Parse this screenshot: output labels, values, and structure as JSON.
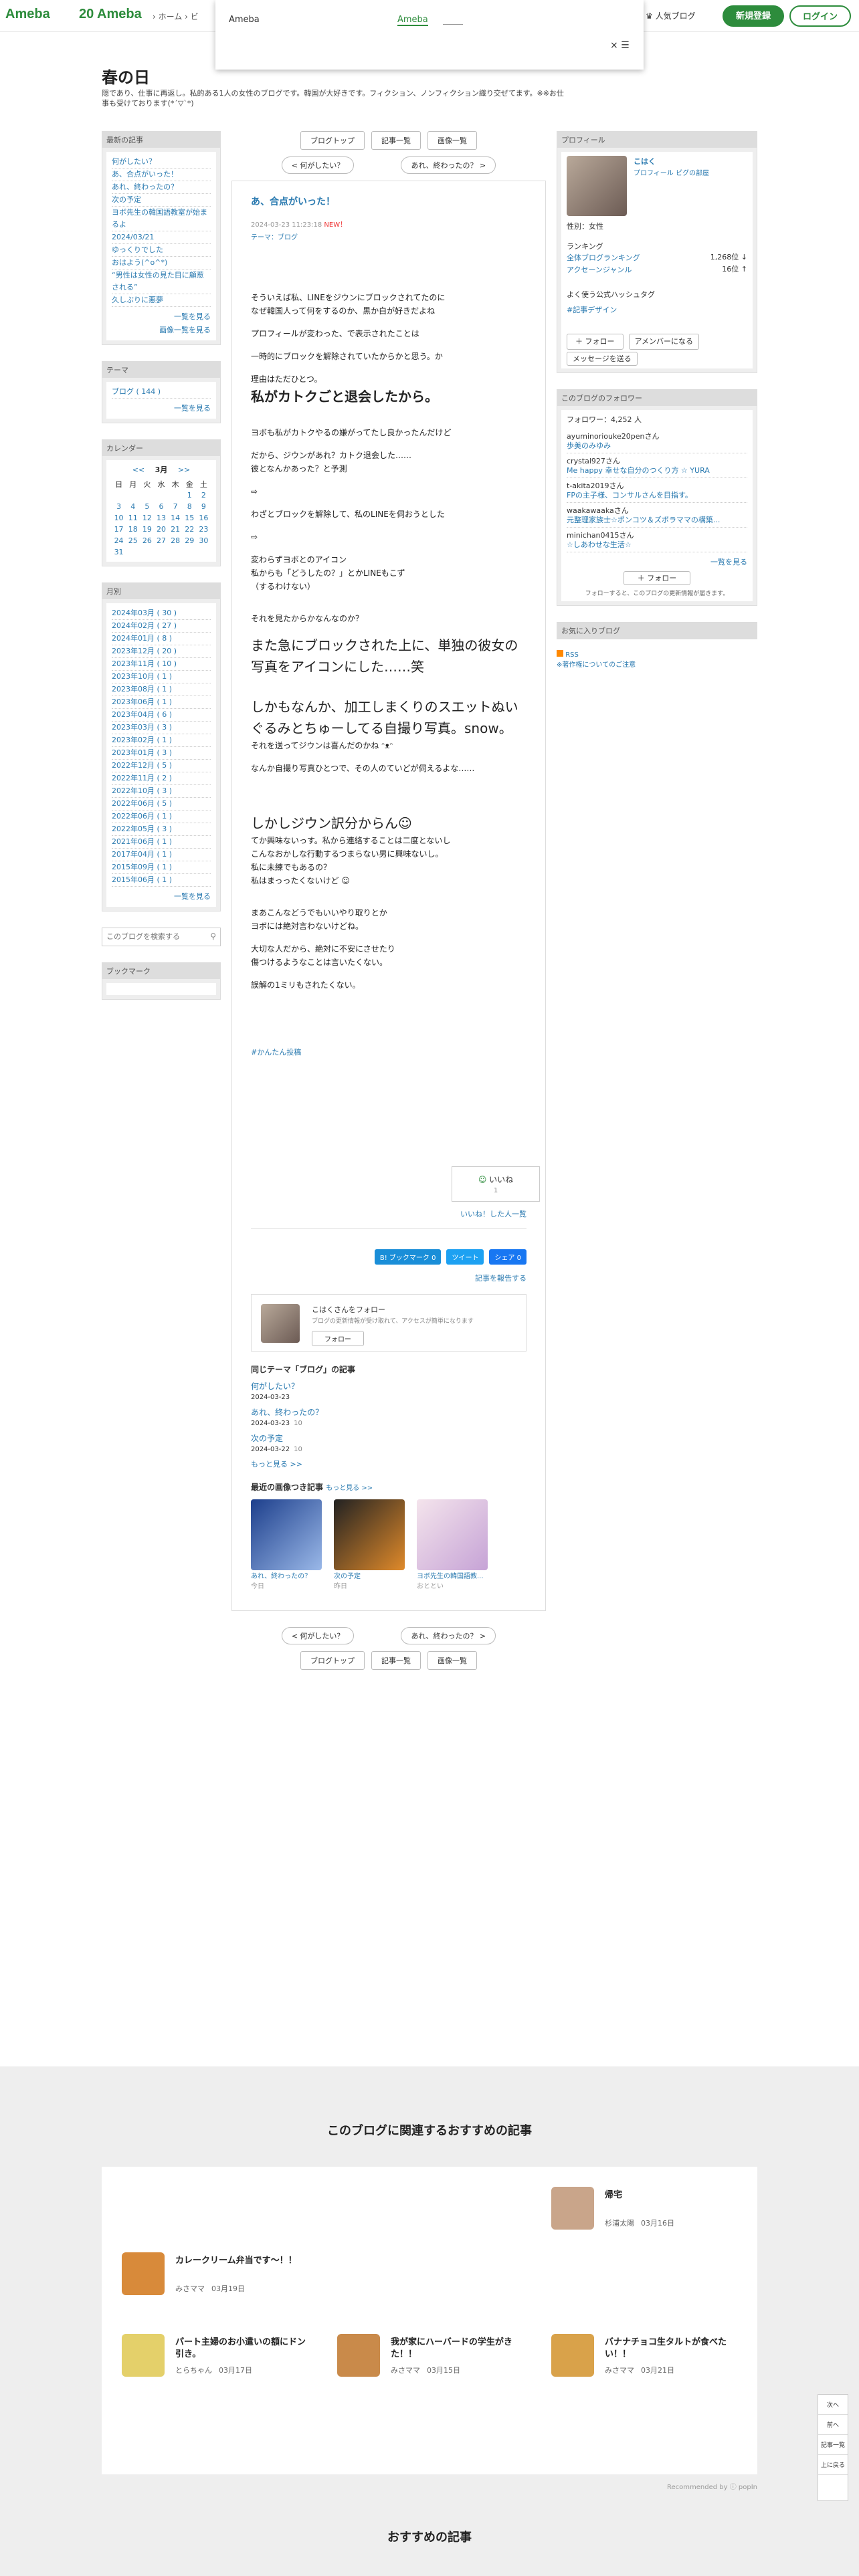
{
  "header": {
    "logo": "Ameba",
    "logo_20": "20 Ameba",
    "nav": "› ホーム  › ビ",
    "popular": "人気ブログ",
    "register": "新規登録",
    "login": "ログイン"
  },
  "overlay": {
    "title": "Ameba",
    "green": "Ameba",
    "close": "× ☰"
  },
  "blog": {
    "title": "春の日",
    "desc": "隠であり、仕事に再返し。私的ある1人の女性のブログです。韓国が大好きです。フィクション、ノンフィクション織り交ぜてます。※※お仕事も受けております(*´▽`*)"
  },
  "left": {
    "recent_h": "最新の記事",
    "recent": [
      "何がしたい？",
      "あ、合点がいった！",
      "あれ、終わったの？",
      "次の予定",
      "ヨボ先生の韓国語教室が始まるよ",
      "2024/03/21",
      "ゆっくりでした",
      "おはよう(^o^*)",
      "“男性は女性の見た目に顧惹される”",
      "久しぶりに悪夢"
    ],
    "more1": "一覧を見る",
    "more2": "画像一覧を見る",
    "theme_h": "テーマ",
    "theme": "ブログ ( 144 )",
    "more3": "一覧を見る",
    "cal_h": "カレンダー",
    "cal_title": "3月",
    "cal_prev": "<<",
    "cal_next": ">>",
    "cal_days": [
      "日",
      "月",
      "火",
      "水",
      "木",
      "金",
      "土"
    ],
    "cal_rows": [
      [
        "",
        "",
        "",
        "",
        "",
        "1",
        "2"
      ],
      [
        "3",
        "4",
        "5",
        "6",
        "7",
        "8",
        "9"
      ],
      [
        "10",
        "11",
        "12",
        "13",
        "14",
        "15",
        "16"
      ],
      [
        "17",
        "18",
        "19",
        "20",
        "21",
        "22",
        "23"
      ],
      [
        "24",
        "25",
        "26",
        "27",
        "28",
        "29",
        "30"
      ],
      [
        "31",
        "",
        "",
        "",
        "",
        "",
        ""
      ]
    ],
    "month_h": "月別",
    "months": [
      "2024年03月 ( 30 )",
      "2024年02月 ( 27 )",
      "2024年01月 ( 8 )",
      "2023年12月 ( 20 )",
      "2023年11月 ( 10 )",
      "2023年10月 ( 1 )",
      "2023年08月 ( 1 )",
      "2023年06月 ( 1 )",
      "2023年04月 ( 6 )",
      "2023年03月 ( 3 )",
      "2023年02月 ( 1 )",
      "2023年01月 ( 3 )",
      "2022年12月 ( 5 )",
      "2022年11月 ( 2 )",
      "2022年10月 ( 3 )",
      "2022年06月 ( 5 )",
      "2022年06月 ( 1 )",
      "2022年05月 ( 3 )",
      "2021年06月 ( 1 )",
      "2017年04月 ( 1 )",
      "2015年09月 ( 1 )",
      "2015年06月 ( 1 )"
    ],
    "more4": "一覧を見る",
    "search_placeholder": "このブログを検索する",
    "bookmark_h": "ブックマーク"
  },
  "main": {
    "tabs": [
      "ブログトップ",
      "記事一覧",
      "画像一覧"
    ],
    "prev": "< 何がしたい？",
    "next": "あれ、終わったの？ >",
    "title": "あ、合点がいった！",
    "date": "2024-03-23 11:23:18",
    "new": "NEW！",
    "theme": "テーマ：ブログ",
    "lines": {
      "l1": "そういえば私、LINEをジウンにブロックされてたのに",
      "l2": "なぜ韓国人って何をするのか、黒か白が好きだよね",
      "l3": "プロフィールが変わった、で表示されたことは",
      "l4": "一時的にブロックを解除されていたからかと思う。か",
      "l5": "理由はただひとつ。",
      "l6": "私がカトクごと退会したから。",
      "l7": "ヨボも私がカトクやるの嫌がってたし良かったんだけど",
      "l8": "だから、ジウンがあれ？カトク退会した……",
      "l9": "彼となんかあった？と予測",
      "l10": "⇨",
      "l11": "わざとブロックを解除して、私のLINEを伺おうとした",
      "l12": "⇨",
      "l13": "変わらずヨボとのアイコン",
      "l14": "私からも「どうしたの？」とかLINEもこず",
      "l15": "（するわけない）",
      "l16": "それを見たからかなんなのか？",
      "l17": "また急にブロックされた上に、単独の彼女の写真をアイコンにした……笑",
      "l18": "しかもなんか、加工しまくりのスエットぬいぐるみとちゅーしてる自撮り写真。snow。",
      "l19": "それを送ってジウンは喜んだのかね ᵔᴥᵔ",
      "l20": "なんか自撮り写真ひとつで、その人のていどが伺えるよな……",
      "l21": "しかしジウン訳分からん",
      "l22": "てか興味ないっす。私から連絡することは二度とないし",
      "l23": "こんなおかしな行動するつまらない男に興味ないし。",
      "l24": "私に未練でもあるの？",
      "l25": "私はまっったくないけど",
      "l26": "まあこんなどうでもいいやり取りとか",
      "l27": "ヨボには絶対言わないけどね。",
      "l28": "大切な人だから、絶対に不安にさせたり",
      "l29": "傷つけるようなことは言いたくない。",
      "l30": "誤解の1ミリもされたくない。",
      "tag": "#かんたん投稿"
    },
    "like": "いいね",
    "like_count": "1",
    "like_list": "いいね！した人一覧",
    "share_b": "B! ブックマーク 0",
    "share_t": "ツイート",
    "share_f": "シェア 0",
    "report": "記事を報告する",
    "follow_title": "こはくさんをフォロー",
    "follow_desc": "ブログの更新情報が受け取れて、アクセスが簡単になります",
    "follow_btn": "フォロー",
    "same_theme_h": "同じテーマ「ブログ」の記事",
    "same": [
      {
        "t": "何がしたい？",
        "d": "2024-03-23"
      },
      {
        "t": "あれ、終わったの？",
        "d": "2024-03-23",
        "c": "10"
      },
      {
        "t": "次の予定",
        "d": "2024-03-22",
        "c": "10"
      }
    ],
    "more": "もっと見る >>",
    "img_h": "最近の画像つき記事",
    "img_more": "もっと見る >>",
    "imgs": [
      {
        "t": "あれ、終わったの？",
        "d": "今日"
      },
      {
        "t": "次の予定",
        "d": "昨日"
      },
      {
        "t": "ヨボ先生の韓国語教...",
        "d": "おととい"
      }
    ]
  },
  "right": {
    "profile_h": "プロフィール",
    "name": "こはく",
    "prof_links": "プロフィール  ピグの部屋",
    "sex": "性別：女性",
    "ranking_h": "ランキング",
    "rank1_l": "全体ブログランキング",
    "rank1_v": "1,268位 ↓",
    "rank2_l": "アクセーンジャンル",
    "rank2_v": "16位 ↑",
    "hashtag_h": "よく使う公式ハッシュタグ",
    "hashtag": "#記事デザイン",
    "follow_btn": "＋ フォロー",
    "member_btn": "アメンバーになる",
    "message_btn": "メッセージを送る",
    "followers_h": "このブログのフォロワー",
    "followers_count": "フォロワー：4,252 人",
    "followers": [
      {
        "n": "ayuminoriouke20penさん",
        "s": "歩美のみゆみ"
      },
      {
        "n": "crystal927さん",
        "s": "Me happy 幸せな自分のつくり方 ☆ YURA"
      },
      {
        "n": "t-akita2019さん",
        "s": "FPの主子様、コンサルさんを目指す。"
      },
      {
        "n": "waakawaakaさん",
        "s": "元整理家族士☆ポンコツ＆ズボラママの構築..."
      },
      {
        "n": "minichan0415さん",
        "s": "☆しあわせな生活☆"
      }
    ],
    "followers_more": "一覧を見る",
    "follow2": "＋ フォロー",
    "follow_note": "フォローすると、このブログの更新情報が届きます。",
    "fav_h": "お気に入りブログ",
    "rss": "RSS",
    "rss2": "※著作権についてのご注意"
  },
  "reco": {
    "title": "このブログに関連するおすすめの記事",
    "items": [
      {
        "t": "帰宅",
        "a": "杉浦太陽",
        "d": "03月16日"
      },
      {
        "t": "カレークリーム弁当です〜！！",
        "a": "みさママ",
        "d": "03月19日"
      },
      {
        "t": "パート主婦のお小遣いの額にドン引き。",
        "a": "とらちゃん",
        "d": "03月17日"
      },
      {
        "t": "我が家にハーバードの学生がきた！！",
        "a": "みさママ",
        "d": "03月15日"
      },
      {
        "t": "バナナチョコ生タルトが食べたい！！",
        "a": "みさママ",
        "d": "03月21日"
      }
    ],
    "powered": "Recommended by ⓘ popIn",
    "title2": "おすすめの記事"
  },
  "floater": [
    "次へ",
    "前へ",
    "記事一覧",
    "上に戻る"
  ]
}
